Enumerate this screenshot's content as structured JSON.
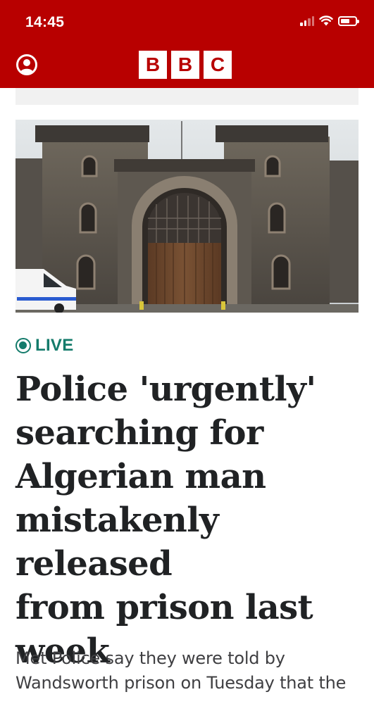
{
  "status_bar": {
    "time": "14:45",
    "icons": [
      "cellular-signal-icon",
      "wifi-icon",
      "battery-icon"
    ]
  },
  "header": {
    "account_icon": "account-icon",
    "logo_letters": [
      "B",
      "B",
      "C"
    ],
    "background_color": "#b80000"
  },
  "hero_image": {
    "subject": "prison-gate-photo"
  },
  "article": {
    "live_label": "LIVE",
    "live_color": "#147b6b",
    "headline_lines": [
      "Police 'urgently'",
      "searching for",
      "Algerian man",
      "mistakenly released",
      "from prison last",
      "week"
    ],
    "summary_lines": [
      "Met Police say they were told by",
      "Wandsworth prison on Tuesday that the"
    ]
  }
}
